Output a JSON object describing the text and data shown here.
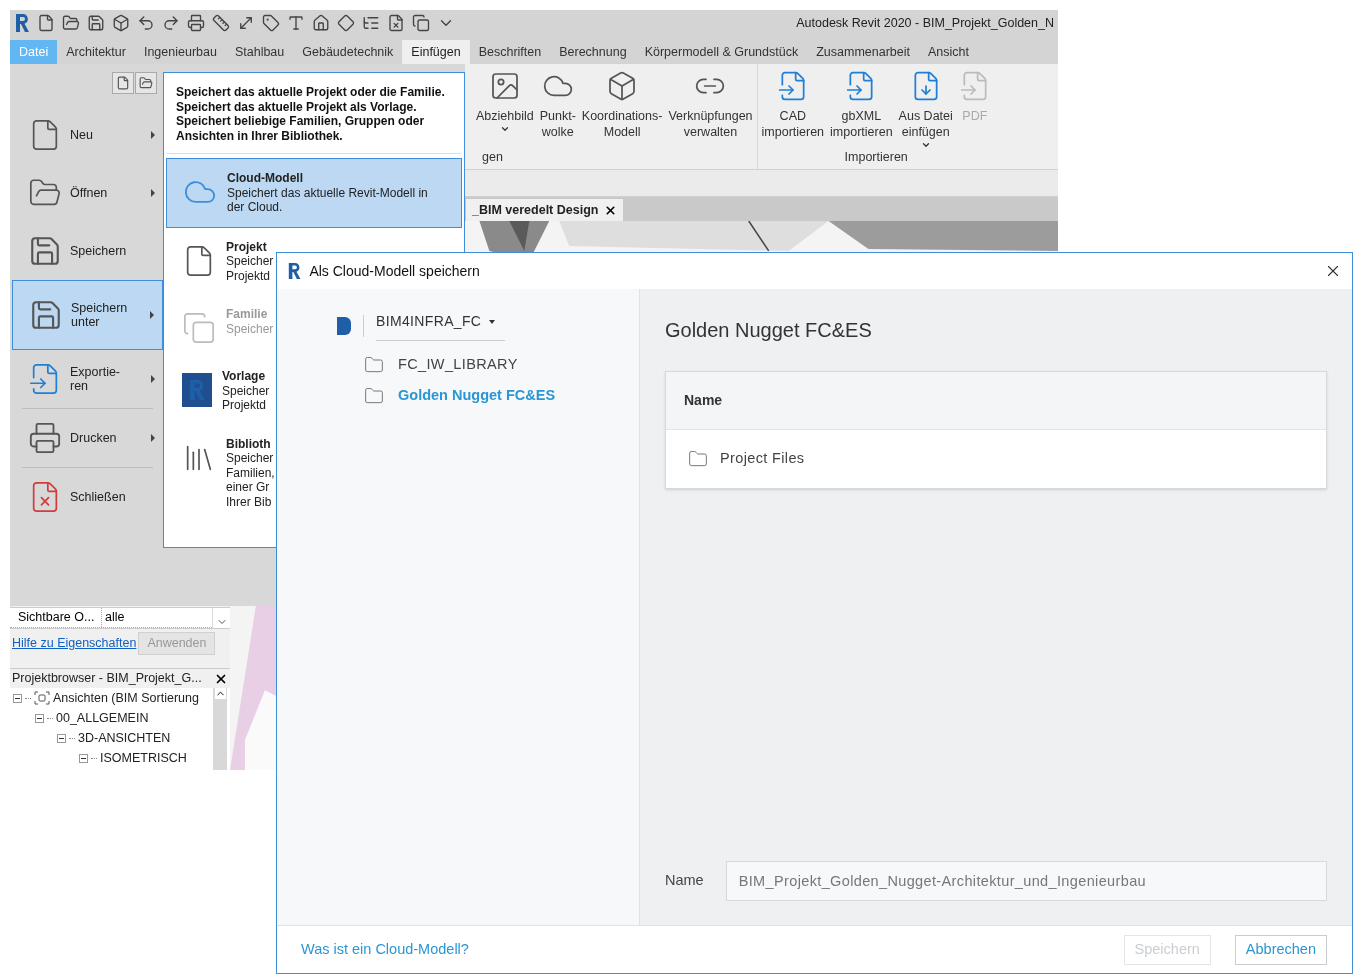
{
  "app": {
    "title": "Autodesk Revit 2020 - BIM_Projekt_Golden_N"
  },
  "ribbon_tabs": [
    {
      "label": "Datei",
      "kind": "file",
      "selected": true
    },
    {
      "label": "Architektur",
      "kind": "tab",
      "selected": false
    },
    {
      "label": "Ingenieurbau",
      "kind": "tab",
      "selected": false
    },
    {
      "label": "Stahlbau",
      "kind": "tab",
      "selected": false
    },
    {
      "label": "Gebäudetechnik",
      "kind": "tab",
      "selected": false
    },
    {
      "label": "Einfügen",
      "kind": "tab",
      "selected": true
    },
    {
      "label": "Beschriften",
      "kind": "tab",
      "selected": false
    },
    {
      "label": "Berechnung",
      "kind": "tab",
      "selected": false
    },
    {
      "label": "Körpermodell & Grundstück",
      "kind": "tab",
      "selected": false
    },
    {
      "label": "Zusammenarbeit",
      "kind": "tab",
      "selected": false
    },
    {
      "label": "Ansicht",
      "kind": "tab",
      "selected": false
    }
  ],
  "ribbon_panels": [
    {
      "label": "gen",
      "buttons": [
        {
          "kind": "decal",
          "lines": [
            "Abziehbild"
          ],
          "dropdown": true,
          "disabled": false
        },
        {
          "kind": "pointcloud",
          "lines": [
            "Punkt-",
            "wolke"
          ],
          "dropdown": false,
          "disabled": false
        },
        {
          "kind": "coordination",
          "lines": [
            "Koordinations-",
            "Modell"
          ],
          "dropdown": false,
          "disabled": false
        },
        {
          "kind": "links",
          "lines": [
            "Verknüpfungen",
            "verwalten"
          ],
          "dropdown": false,
          "disabled": false
        }
      ]
    },
    {
      "label": "Importieren",
      "buttons": [
        {
          "kind": "cad",
          "lines": [
            "CAD",
            "importieren"
          ],
          "dropdown": false,
          "disabled": false
        },
        {
          "kind": "gbxml",
          "lines": [
            "gbXML",
            "importieren"
          ],
          "dropdown": false,
          "disabled": false
        },
        {
          "kind": "insert",
          "lines": [
            "Aus Datei",
            "einfügen"
          ],
          "dropdown": true,
          "disabled": false
        },
        {
          "kind": "pdf",
          "lines": [
            "PDF"
          ],
          "dropdown": false,
          "disabled": true
        }
      ]
    }
  ],
  "view_tabs": [
    {
      "label": "_BIM veredelt Design"
    }
  ],
  "file_menu": {
    "items": [
      {
        "kind": "new",
        "lines": [
          "Neu"
        ],
        "submenu": true,
        "selected": false
      },
      {
        "kind": "open",
        "lines": [
          "Öffnen"
        ],
        "submenu": true,
        "selected": false
      },
      {
        "kind": "save",
        "lines": [
          "Speichern"
        ],
        "submenu": false,
        "selected": false
      },
      {
        "kind": "saveas",
        "lines": [
          "Speichern",
          "unter"
        ],
        "submenu": true,
        "selected": true
      },
      {
        "kind": "export",
        "lines": [
          "Exportie-",
          "ren"
        ],
        "submenu": true,
        "selected": false
      },
      {
        "kind": "print",
        "lines": [
          "Drucken"
        ],
        "submenu": true,
        "selected": false
      },
      {
        "kind": "close",
        "lines": [
          "Schließen"
        ],
        "submenu": false,
        "selected": false
      }
    ],
    "flyout": {
      "description": [
        "Speichert das aktuelle Projekt oder die Familie.",
        "Speichert das aktuelle Projekt als Vorlage.",
        "Speichert beliebige Familien, Gruppen oder",
        "Ansichten in Ihrer Bibliothek."
      ],
      "items": [
        {
          "kind": "cloud",
          "title": "Cloud-Modell",
          "lines": [
            "Speichert das aktuelle Revit-Modell in",
            "der Cloud."
          ],
          "selected": true,
          "disabled": false
        },
        {
          "kind": "project",
          "title": "Projekt",
          "lines": [
            "Speicher",
            "Projektd"
          ],
          "selected": false,
          "disabled": false
        },
        {
          "kind": "family",
          "title": "Familie",
          "lines": [
            "Speicher"
          ],
          "selected": false,
          "disabled": true
        },
        {
          "kind": "template",
          "title": "Vorlage",
          "lines": [
            "Speicher",
            "Projektd"
          ],
          "selected": false,
          "disabled": false
        },
        {
          "kind": "library",
          "title": "Biblioth",
          "lines": [
            "Speicher",
            "Familien,",
            "einer Gr",
            "Ihrer Bib"
          ],
          "selected": false,
          "disabled": false
        }
      ]
    }
  },
  "properties": {
    "rows": [
      {
        "label": "Sichtbare O...",
        "value": "alle"
      }
    ],
    "help_link": "Hilfe zu Eigenschaften",
    "apply_button": {
      "label": "Anwenden",
      "disabled": true
    }
  },
  "project_browser": {
    "title": "Projektbrowser - BIM_Projekt_G...",
    "tree": [
      {
        "label": "Ansichten (BIM Sortierung",
        "expanded": true,
        "children": [
          {
            "label": "00_ALLGEMEIN",
            "expanded": true,
            "children": [
              {
                "label": "3D-ANSICHTEN",
                "expanded": true,
                "children": [
                  {
                    "label": "ISOMETRISCH",
                    "expanded": true
                  }
                ]
              }
            ]
          }
        ]
      }
    ]
  },
  "dialog": {
    "title": "Als Cloud-Modell speichern",
    "hub": {
      "name": "BIM4INFRA_FC"
    },
    "folders": [
      {
        "label": "FC_IW_LIBRARY",
        "selected": false
      },
      {
        "label": "Golden Nugget FC&ES",
        "selected": true
      }
    ],
    "heading": "Golden Nugget FC&ES",
    "table": {
      "columns": [
        "Name"
      ],
      "rows": [
        {
          "name": "Project Files"
        }
      ]
    },
    "name_field": {
      "label": "Name",
      "value": "BIM_Projekt_Golden_Nugget-Architektur_und_Ingenieurbau"
    },
    "help_link": "Was ist ein Cloud-Modell?",
    "buttons": [
      {
        "label": "Speichern",
        "disabled": true
      },
      {
        "label": "Abbrechen",
        "disabled": false
      }
    ]
  }
}
